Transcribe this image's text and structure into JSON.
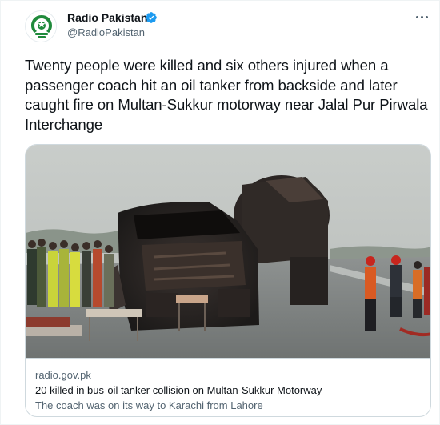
{
  "author": {
    "display_name": "Radio Pakistan",
    "handle": "@RadioPakistan",
    "verified": true
  },
  "tweet": {
    "text": "Twenty people were killed and six others injured when a passenger coach hit an oil tanker from backside and later caught fire on Multan-Sukkur motorway near Jalal Pur Pirwala Interchange"
  },
  "link_card": {
    "domain": "radio.gov.pk",
    "title": "20 killed in bus-oil tanker collision on Multan-Sukkur Motorway",
    "description": "The coach was on its way to Karachi from Lahore"
  },
  "colors": {
    "verified_blue": "#1d9bf0",
    "avatar_green": "#1f8a3b",
    "secondary_text": "#536471"
  },
  "icons": [
    "radio-pakistan-logo-icon",
    "verified-badge-icon",
    "more-options-icon"
  ]
}
